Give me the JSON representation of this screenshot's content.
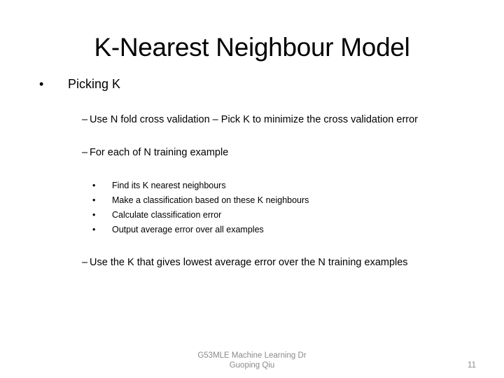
{
  "slide": {
    "title": "K-Nearest Neighbour Model",
    "bullets": [
      {
        "marker": "•",
        "text": "Picking K",
        "sub": [
          {
            "marker": "–",
            "text": "Use N fold cross validation – Pick K to minimize the cross validation error"
          },
          {
            "marker": "–",
            "text": "For each of N training example",
            "sub": [
              {
                "marker": "•",
                "text": "Find its K nearest neighbours"
              },
              {
                "marker": "•",
                "text": "Make a classification based on these K neighbours"
              },
              {
                "marker": "•",
                "text": "Calculate classification error"
              },
              {
                "marker": "•",
                "text": "Output average error over all examples"
              }
            ]
          },
          {
            "marker": "–",
            "text": "Use the K that gives lowest average error over the N training examples"
          }
        ]
      }
    ]
  },
  "footer": {
    "course_line1": "G53MLE  Machine Learning Dr",
    "course_line2": "Guoping Qiu",
    "page_number": "11"
  }
}
